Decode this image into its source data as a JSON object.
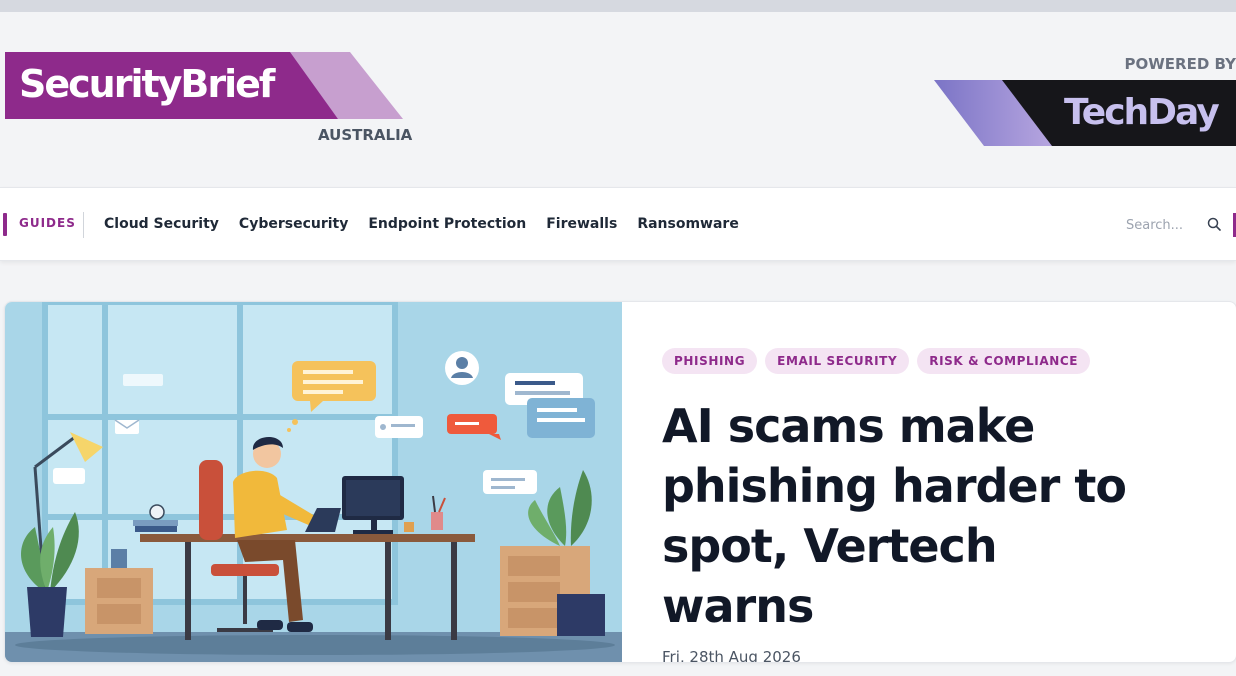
{
  "header": {
    "brand_name": "SecurityBrief",
    "region": "AUSTRALIA",
    "powered_by": "POWERED BY",
    "partner_name": "TechDay",
    "brand_color": "#8e2a8b"
  },
  "nav": {
    "guides_label": "GUIDES",
    "items": [
      "Cloud Security",
      "Cybersecurity",
      "Endpoint Protection",
      "Firewalls",
      "Ransomware"
    ],
    "search_placeholder": "Search...",
    "search_icon": "search-icon"
  },
  "featured": {
    "tags": [
      "PHISHING",
      "EMAIL SECURITY",
      "RISK & COMPLIANCE"
    ],
    "headline": "AI scams make phishing harder to spot, Vertech warns",
    "date": "Fri, 28th Aug 2026",
    "image": "illustration of a person working at a laptop with chat bubbles and notifications"
  }
}
